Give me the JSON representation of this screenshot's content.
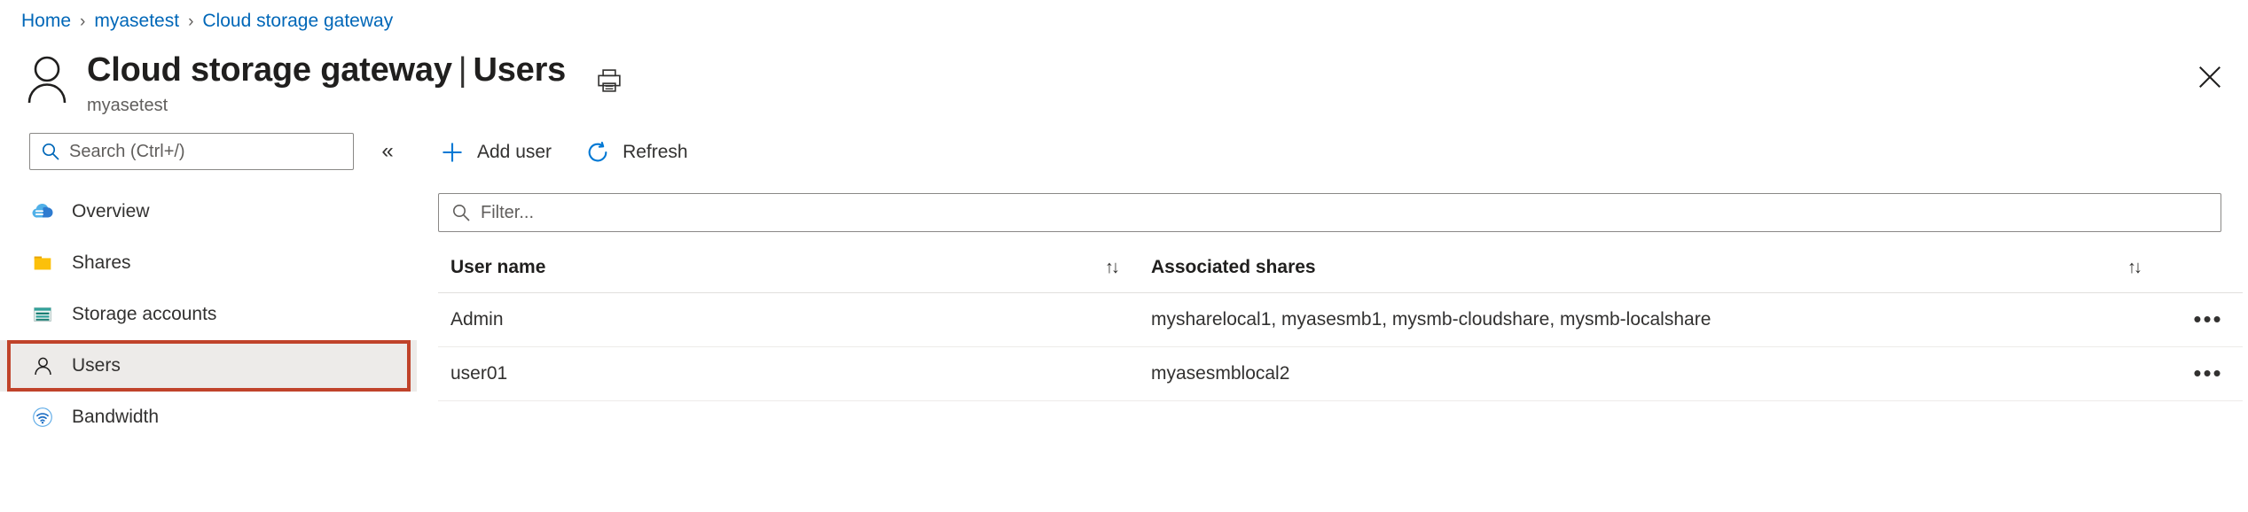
{
  "breadcrumb": {
    "items": [
      {
        "label": "Home"
      },
      {
        "label": "myasetest"
      },
      {
        "label": "Cloud storage gateway"
      }
    ],
    "separator": "›"
  },
  "header": {
    "resource_title": "Cloud storage gateway",
    "title_separator": "|",
    "page_title": "Users",
    "subtitle": "myasetest",
    "avatar_icon": "person-icon",
    "print_icon": "print-icon",
    "close_icon": "close-icon"
  },
  "sidebar": {
    "search": {
      "placeholder": "Search (Ctrl+/)",
      "value": "",
      "icon": "search-icon"
    },
    "collapse_label": "«",
    "items": [
      {
        "label": "Overview",
        "icon": "cloud-icon",
        "selected": false
      },
      {
        "label": "Shares",
        "icon": "folder-icon",
        "selected": false
      },
      {
        "label": "Storage accounts",
        "icon": "storage-account-icon",
        "selected": false
      },
      {
        "label": "Users",
        "icon": "person-icon",
        "selected": true
      },
      {
        "label": "Bandwidth",
        "icon": "bandwidth-icon",
        "selected": false
      }
    ],
    "highlight_color": "#c0432a"
  },
  "toolbar": {
    "add_user_label": "Add user",
    "add_user_icon": "plus-icon",
    "refresh_label": "Refresh",
    "refresh_icon": "refresh-icon"
  },
  "filter": {
    "placeholder": "Filter...",
    "value": "",
    "icon": "search-icon"
  },
  "table": {
    "columns": [
      {
        "label": "User name",
        "sortable": true,
        "sort_icon": "↑↓"
      },
      {
        "label": "Associated shares",
        "sortable": true,
        "sort_icon": "↑↓"
      },
      {
        "label": "",
        "sortable": false,
        "sort_icon": ""
      }
    ],
    "rows": [
      {
        "user_name": "Admin",
        "associated_shares": "mysharelocal1, myasesmb1, mysmb-cloudshare, mysmb-localshare",
        "actions": "•••"
      },
      {
        "user_name": "user01",
        "associated_shares": "myasesmblocal2",
        "actions": "•••"
      }
    ]
  },
  "colors": {
    "link": "#0067b8",
    "accent": "#0078d4",
    "selected_row_bg": "#edebe9",
    "annotation": "#c0432a"
  }
}
